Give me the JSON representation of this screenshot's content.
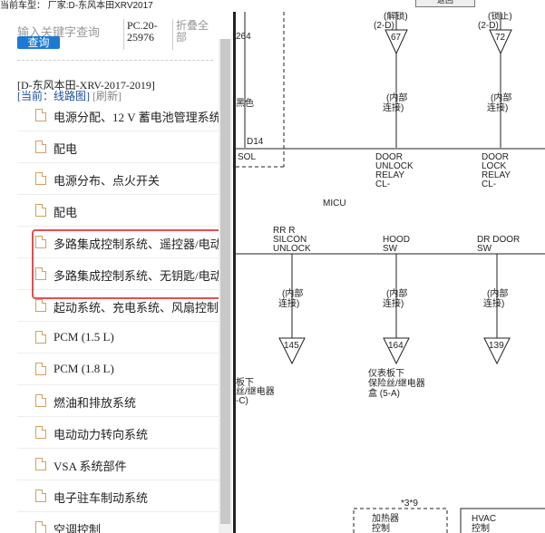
{
  "topbar": {
    "title": "当前车型： 厂家:D-东风本田XRV2017",
    "button_partial": "返回"
  },
  "sidebar": {
    "search_placeholder": "输入关键字查询",
    "search_button": "查询",
    "pc_code": "PC.20-25976",
    "collapse_all": "折叠全部",
    "model": "[D-东风本田-XRV-2017-2019]",
    "current_prefix": "[当前：",
    "current_value": "线路图",
    "current_suffix": "]",
    "refresh": "[刷新]",
    "items": [
      {
        "label": "电源分配、12 V 蓄电池管理系统"
      },
      {
        "label": "配电"
      },
      {
        "label": "电源分布、点火开关"
      },
      {
        "label": "配电"
      },
      {
        "label": "多路集成控制系统、遥控器/电动"
      },
      {
        "label": "多路集成控制系统、无钥匙/电动"
      },
      {
        "label": "起动系统、充电系统、风扇控制"
      },
      {
        "label": "PCM (1.5 L)"
      },
      {
        "label": "PCM (1.8 L)"
      },
      {
        "label": "燃油和排放系统"
      },
      {
        "label": "电动动力转向系统"
      },
      {
        "label": "VSA 系统部件"
      },
      {
        "label": "电子驻车制动系统"
      },
      {
        "label": "空调控制"
      }
    ]
  },
  "diagram": {
    "unlock_top": "(解锁)",
    "lock_top": "(锁止)",
    "pin_2d": "(2-D)",
    "conn_264": "264",
    "conn_67": "67",
    "conn_72": "72",
    "internal": "(内部",
    "connect": "连接)",
    "color_label": "黑色",
    "d14": "D14",
    "sol": "SOL",
    "door_unlock": [
      "DOOR",
      "UNLOCK",
      "RELAY",
      "CL-"
    ],
    "door_lock": [
      "DOOR",
      "LOCK",
      "RELAY",
      "CL-"
    ],
    "micu": "MICU",
    "rr_silcon": [
      "RR R",
      "SILCON",
      "UNLOCK"
    ],
    "hood_sw": [
      "HOOD",
      "SW"
    ],
    "dr_door_sw": [
      "DR DOOR",
      "SW"
    ],
    "conn_145": "145",
    "conn_164": "164",
    "conn_139": "139",
    "left_frag": [
      "板下",
      "丝/继电器",
      "-C)"
    ],
    "under_dash": [
      "仪表板下",
      "保险丝/继电器",
      "盒 (5-A)"
    ],
    "star39": "*3*9",
    "heater": [
      "加热器",
      "控制"
    ],
    "hvac": [
      "HVAC",
      "控制"
    ]
  }
}
